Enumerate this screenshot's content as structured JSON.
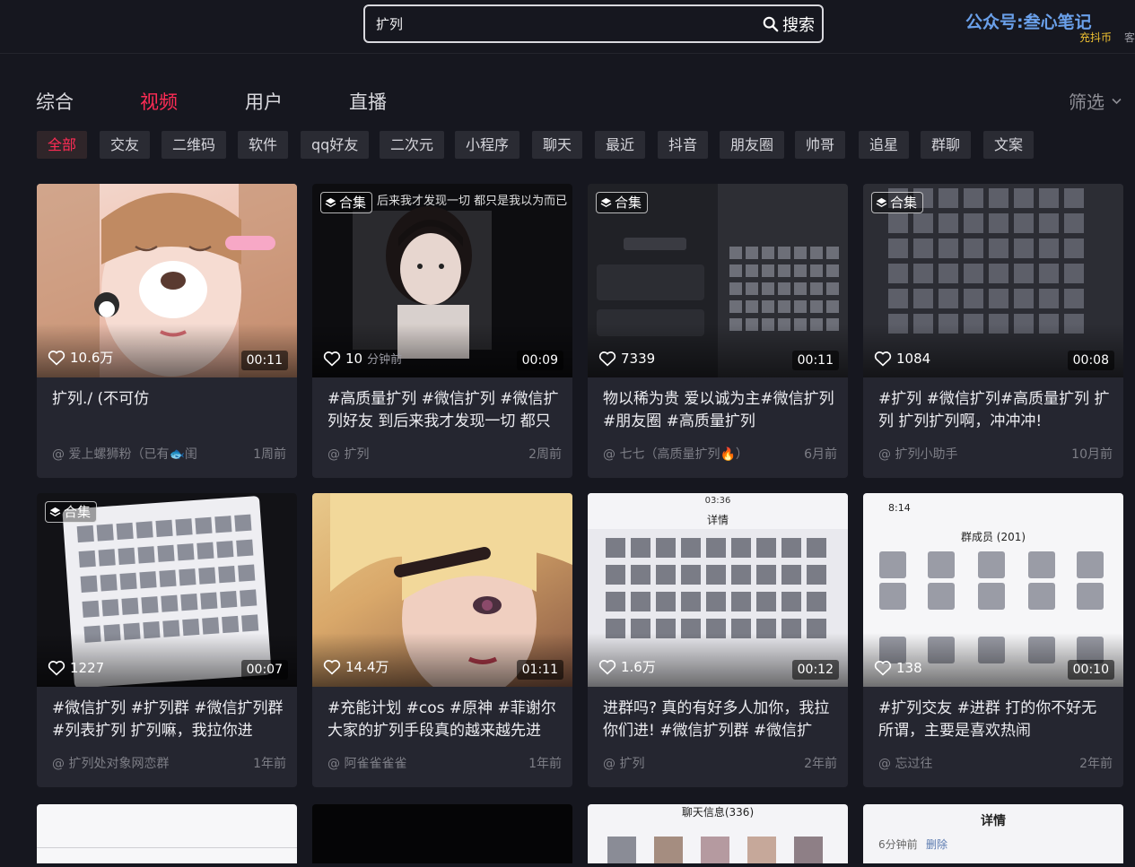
{
  "search": {
    "value": "扩列",
    "button_label": "搜索"
  },
  "watermark": "公众号:叁心笔记",
  "coin_label": "充抖币",
  "cust_label": "客",
  "tabs": [
    {
      "label": "综合"
    },
    {
      "label": "视频"
    },
    {
      "label": "用户"
    },
    {
      "label": "直播"
    }
  ],
  "filter_label": "筛选",
  "chips": [
    "全部",
    "交友",
    "二维码",
    "软件",
    "qq好友",
    "二次元",
    "小程序",
    "聊天",
    "最近",
    "抖音",
    "朋友圈",
    "帅哥",
    "追星",
    "群聊",
    "文案"
  ],
  "heji_label": "合集",
  "cards": [
    {
      "likes": "10.6万",
      "duration": "00:11",
      "title": "扩列./ (不可仿",
      "author": "@ 爱上螺狮粉（已有🐟闺",
      "time": "1周前"
    },
    {
      "likes": "10",
      "duration": "00:09",
      "title": "#高质量扩列 #微信扩列 #微信扩列好友 到后来我才发现一切 都只是...",
      "author": "@ 扩列",
      "time": "2周前",
      "overlay_text": "后来我才发现一切 都只是我以为而已",
      "sub_text": "分钟前"
    },
    {
      "likes": "7339",
      "duration": "00:11",
      "title": "物以稀为贵 爱以诚为主#微信扩列 #朋友圈 #高质量扩列",
      "author": "@ 七七（高质量扩列🔥）",
      "time": "6月前"
    },
    {
      "likes": "1084",
      "duration": "00:08",
      "title": "#扩列 #微信扩列#高质量扩列 扩列 扩列扩列啊，冲冲冲!",
      "author": "@ 扩列小助手",
      "time": "10月前"
    },
    {
      "likes": "1227",
      "duration": "00:07",
      "title": "#微信扩列 #扩列群 #微信扩列群 #列表扩列 扩列嘛，我拉你进",
      "author": "@ 扩列处对象网恋群",
      "time": "1年前"
    },
    {
      "likes": "14.4万",
      "duration": "01:11",
      "title": "#充能计划 #cos #原神 #菲谢尔 大家的扩列手段真的越来越先进了...",
      "author": "@ 阿雀雀雀雀",
      "time": "1年前"
    },
    {
      "likes": "1.6万",
      "duration": "00:12",
      "title": "进群吗? 真的有好多人加你，我拉你们进! #微信扩列群 #微信扩列...",
      "author": "@ 扩列",
      "time": "2年前",
      "phone_title": "详情",
      "phone_time": "03:36"
    },
    {
      "likes": "138",
      "duration": "00:10",
      "title": "#扩列交友 #进群 打的你不好无所谓，主要是喜欢热闹 @DOU+小...",
      "author": "@ 忘过往",
      "time": "2年前",
      "phone_title": "群成员 (201)",
      "phone_time": "8:14"
    }
  ],
  "partial_cards": [
    {
      "text": ""
    },
    {
      "text": ""
    },
    {
      "text": "聊天信息(336)"
    },
    {
      "text": "详情",
      "sub": "6分钟前",
      "sub2": "删除"
    }
  ],
  "colors": {
    "accent": "#fe2c55",
    "background": "#16171f",
    "card": "#252630"
  }
}
